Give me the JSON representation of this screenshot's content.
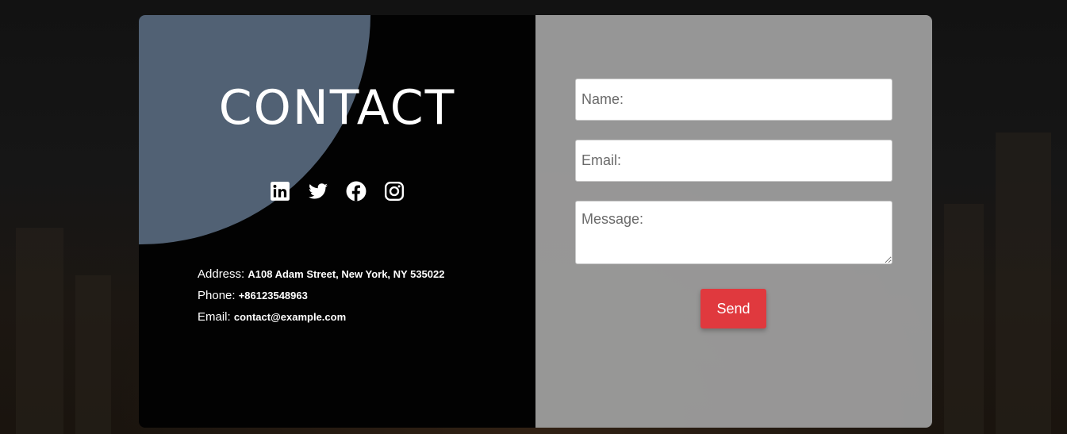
{
  "colors": {
    "page_background": "#141414",
    "left_panel": "#020202",
    "accent_circle": "#516174",
    "right_panel": "#9b9b9b",
    "send_button": "#e0393e"
  },
  "contact": {
    "title": "CONTACT",
    "social_icons": [
      "linkedin-icon",
      "twitter-icon",
      "facebook-icon",
      "instagram-icon"
    ],
    "address_label": "Address:",
    "address_value": "A108 Adam Street, New York, NY 535022",
    "phone_label": "Phone:",
    "phone_value": "+86123548963",
    "email_label": "Email:",
    "email_value": "contact@example.com"
  },
  "form": {
    "name_placeholder": "Name:",
    "email_placeholder": "Email:",
    "message_placeholder": "Message:",
    "send_label": "Send"
  }
}
